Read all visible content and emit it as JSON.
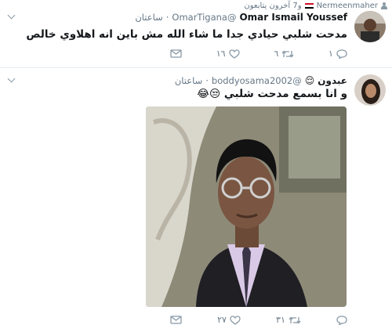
{
  "context": {
    "retweeter": "Nermeenmaher",
    "others": "و7 آخرون يتابعون"
  },
  "tweet1": {
    "name": "Omar Ismail Youssef",
    "handle": "@OmarTigana",
    "time": "ساعتان",
    "text": "مدحت شلبي حيادي جدا ما شاء الله مش باين انه اهلاوي خالص",
    "replies": "١",
    "retweets": "٦",
    "likes": "١٦"
  },
  "tweet2": {
    "name": "عبدون",
    "name_emoji": "😌",
    "handle": "@boddyosama2002",
    "time": "ساعتان",
    "text": "و انا بسمع مدحت شلبي 😒😂",
    "retweets": "٣١",
    "likes": "٢٧"
  },
  "colors": {
    "muted": "#657786",
    "border": "#e6ecf0",
    "text": "#14171a"
  },
  "icons": [
    "person-icon",
    "egypt-flag-icon",
    "chevron-down-icon",
    "reply-icon",
    "retweet-icon",
    "like-icon",
    "message-icon"
  ]
}
